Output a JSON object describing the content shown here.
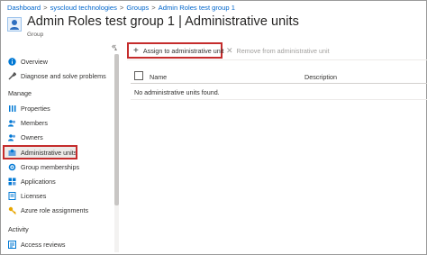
{
  "breadcrumb": [
    {
      "label": "Dashboard"
    },
    {
      "label": "syscloud technologies"
    },
    {
      "label": "Groups"
    },
    {
      "label": "Admin Roles test group 1"
    }
  ],
  "breadcrumb_separator": ">",
  "header": {
    "title": "Admin Roles test group 1 | Administrative units",
    "subtitle": "Group",
    "icon": "group-icon"
  },
  "sidebar": {
    "collapse_glyph": "«",
    "items": [
      {
        "label": "Overview",
        "icon": "info-icon"
      },
      {
        "label": "Diagnose and solve problems",
        "icon": "wrench-icon"
      },
      {
        "section": "Manage"
      },
      {
        "label": "Properties",
        "icon": "properties-icon"
      },
      {
        "label": "Members",
        "icon": "people-icon"
      },
      {
        "label": "Owners",
        "icon": "people-icon"
      },
      {
        "label": "Administrative units",
        "icon": "admin-units-icon",
        "selected": true
      },
      {
        "label": "Group memberships",
        "icon": "gear-icon"
      },
      {
        "label": "Applications",
        "icon": "apps-icon"
      },
      {
        "label": "Licenses",
        "icon": "license-icon"
      },
      {
        "label": "Azure role assignments",
        "icon": "key-icon"
      },
      {
        "section": "Activity"
      },
      {
        "label": "Access reviews",
        "icon": "access-review-icon"
      }
    ]
  },
  "toolbar": {
    "assign_label": "Assign to administrative unit",
    "remove_label": "Remove from administrative unit"
  },
  "table": {
    "columns": [
      "Name",
      "Description"
    ],
    "empty_message": "No administrative units found."
  },
  "colors": {
    "link": "#0066cc",
    "highlight_box": "#c52c2c",
    "selected_bg": "#edebe9",
    "disabled_text": "#a19f9d"
  }
}
